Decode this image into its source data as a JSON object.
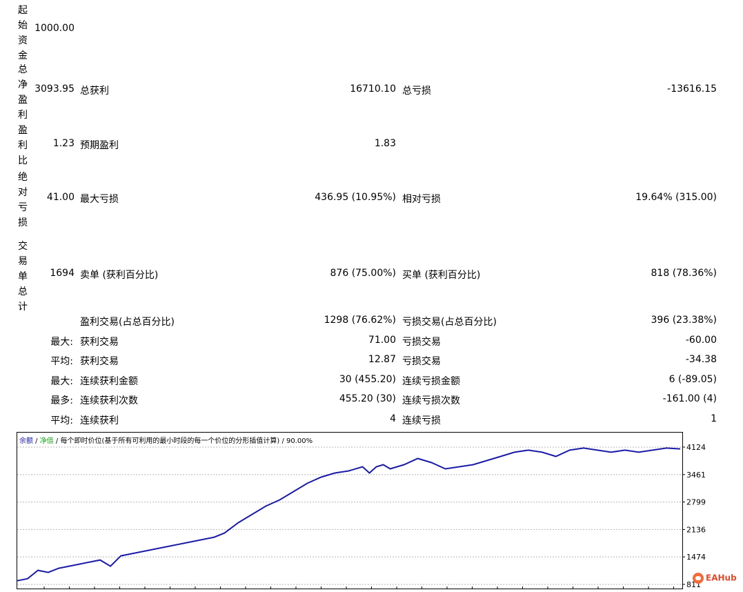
{
  "labels": {
    "initial_deposit": "起始资金",
    "total_net_profit": "总净盈利",
    "profit_factor": "盈利比",
    "absolute_drawdown": "绝对亏损",
    "total_trades": "交易单总计"
  },
  "values": {
    "initial_deposit": "1000.00",
    "total_net_profit": "3093.95",
    "profit_factor": "1.23",
    "absolute_drawdown": "41.00",
    "total_trades": "1694"
  },
  "rows": {
    "r1": {
      "l1": "总获利",
      "v1": "16710.10",
      "l2": "总亏损",
      "v2": "-13616.15"
    },
    "r2": {
      "l1": "预期盈利",
      "v1": "1.83"
    },
    "r3": {
      "l1": "最大亏损",
      "v1": "436.95 (10.95%)",
      "l2": "相对亏损",
      "v2": "19.64% (315.00)"
    },
    "r4": {
      "l1": "卖单 (获利百分比)",
      "v1": "876 (75.00%)",
      "l2": "买单 (获利百分比)",
      "v2": "818 (78.36%)"
    },
    "r5": {
      "l1": "盈利交易(占总百分比)",
      "v1": "1298 (76.62%)",
      "l2": "亏损交易(占总百分比)",
      "v2": "396 (23.38%)"
    },
    "r6": {
      "p": "最大:",
      "l1": "获利交易",
      "v1": "71.00",
      "l2": "亏损交易",
      "v2": "-60.00"
    },
    "r7": {
      "p": "平均:",
      "l1": "获利交易",
      "v1": "12.87",
      "l2": "亏损交易",
      "v2": "-34.38"
    },
    "r8": {
      "p": "最大:",
      "l1": "连续获利金额",
      "v1": "30 (455.20)",
      "l2": "连续亏损金额",
      "v2": "6 (-89.05)"
    },
    "r9": {
      "p": "最多:",
      "l1": "连续获利次数",
      "v1": "455.20 (30)",
      "l2": "连续亏损次数",
      "v2": "-161.00 (4)"
    },
    "r10": {
      "p": "平均:",
      "l1": "连续获利",
      "v1": "4",
      "l2": "连续亏损",
      "v2": "1"
    }
  },
  "chart_legend": {
    "balance": "余额",
    "sep1": " / ",
    "equity": "净值",
    "sep2": " / ",
    "model": "每个即时价位(基于所有可利用的最小时段的每一个价位的分形插值计算) / 90.00%"
  },
  "watermark": "EAHub",
  "colors": {
    "balance_line": "#1a1aa8",
    "grid": "#b4b4b4"
  },
  "chart_data": {
    "type": "line",
    "title": "",
    "xlabel": "",
    "ylabel": "",
    "ylim": [
      811,
      4124
    ],
    "yticks": [
      4124,
      3461,
      2799,
      2136,
      1474,
      811
    ],
    "series": [
      {
        "name": "余额",
        "x": [
          0,
          15,
          30,
          45,
          60,
          75,
          90,
          105,
          120,
          135,
          150,
          165,
          180,
          195,
          210,
          225,
          240,
          255,
          270,
          285,
          300,
          320,
          340,
          360,
          380,
          400,
          420,
          440,
          460,
          480,
          500,
          510,
          520,
          530,
          540,
          560,
          580,
          600,
          620,
          640,
          660,
          680,
          700,
          720,
          740,
          760,
          780,
          800,
          820,
          840,
          860,
          880,
          900,
          920,
          940,
          960
        ],
        "values": [
          900,
          950,
          1150,
          1100,
          1200,
          1250,
          1300,
          1350,
          1400,
          1250,
          1500,
          1550,
          1600,
          1650,
          1700,
          1750,
          1800,
          1850,
          1900,
          1950,
          2050,
          2300,
          2500,
          2700,
          2850,
          3050,
          3250,
          3400,
          3500,
          3550,
          3650,
          3500,
          3650,
          3700,
          3600,
          3700,
          3850,
          3750,
          3600,
          3650,
          3700,
          3800,
          3900,
          4000,
          4050,
          4000,
          3900,
          4050,
          4100,
          4050,
          4000,
          4050,
          4000,
          4050,
          4100,
          4080
        ]
      }
    ]
  }
}
